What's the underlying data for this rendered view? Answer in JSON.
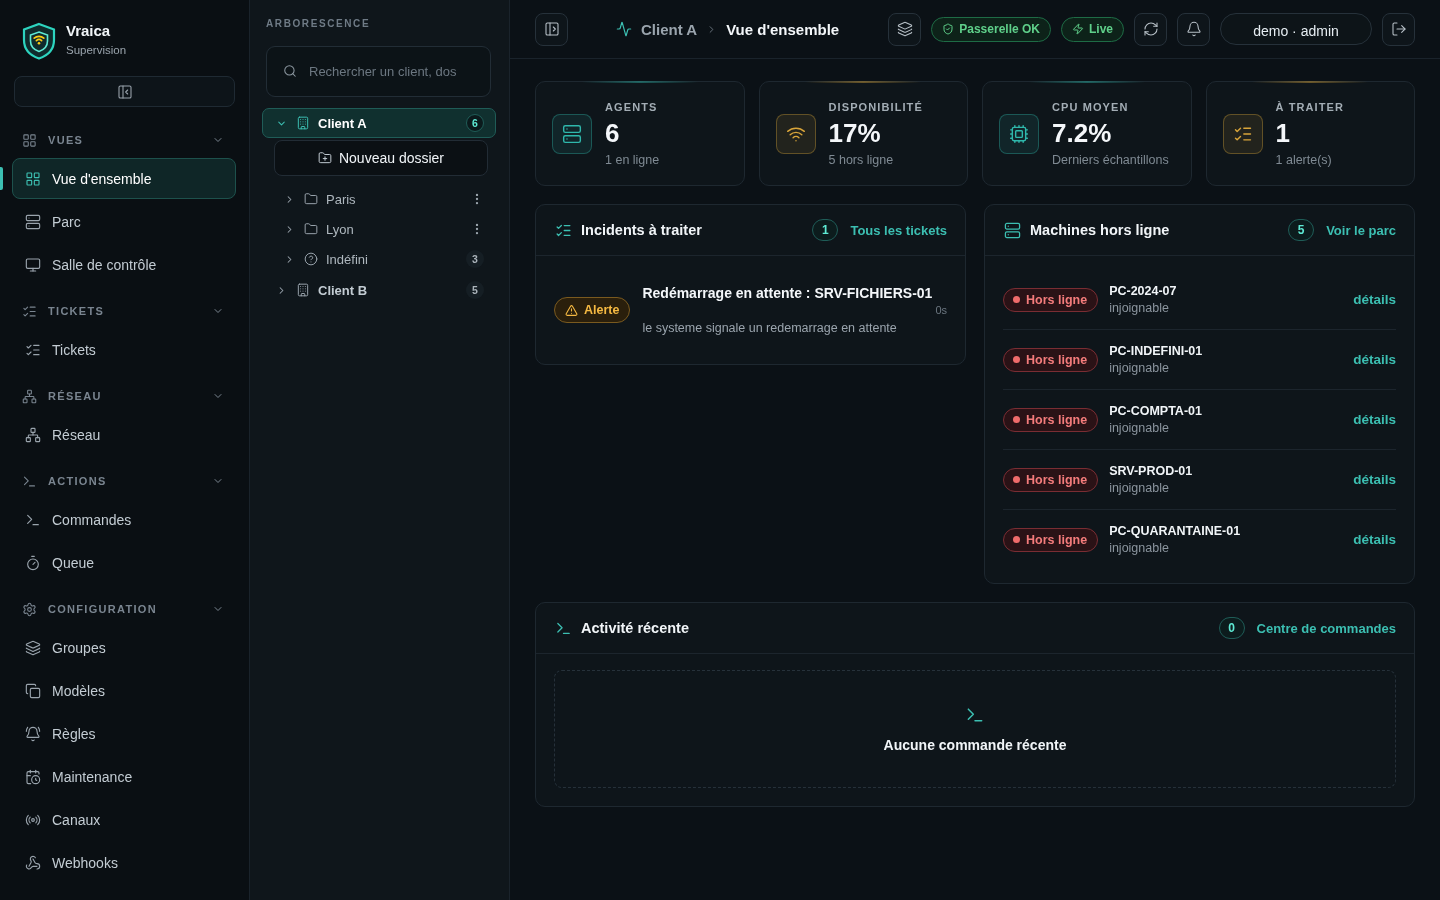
{
  "brand": {
    "name": "Vraica",
    "subtitle": "Supervision"
  },
  "sidebar": {
    "sections": [
      {
        "title": "VUES",
        "expanded": true,
        "items": [
          {
            "label": "Vue d'ensemble",
            "selected": true
          },
          {
            "label": "Parc",
            "selected": false
          },
          {
            "label": "Salle de contrôle",
            "selected": false
          }
        ]
      },
      {
        "title": "TICKETS",
        "expanded": true,
        "items": [
          {
            "label": "Tickets",
            "selected": false
          }
        ]
      },
      {
        "title": "RÉSEAU",
        "expanded": true,
        "items": [
          {
            "label": "Réseau",
            "selected": false
          }
        ]
      },
      {
        "title": "ACTIONS",
        "expanded": true,
        "items": [
          {
            "label": "Commandes",
            "selected": false
          },
          {
            "label": "Queue",
            "selected": false
          }
        ]
      },
      {
        "title": "CONFIGURATION",
        "expanded": true,
        "items": [
          {
            "label": "Groupes",
            "selected": false
          },
          {
            "label": "Modèles",
            "selected": false
          },
          {
            "label": "Règles",
            "selected": false
          },
          {
            "label": "Maintenance",
            "selected": false
          },
          {
            "label": "Canaux",
            "selected": false
          },
          {
            "label": "Webhooks",
            "selected": false
          }
        ]
      }
    ]
  },
  "tree": {
    "title": "ARBORESCENCE",
    "search": {
      "placeholder": "Rechercher un client, dos"
    },
    "nodes": [
      {
        "kind": "client",
        "label": "Client A",
        "count": "6",
        "selected": true,
        "expanded": true,
        "new_folder_button": "Nouveau dossier",
        "children": [
          {
            "kind": "folder",
            "label": "Paris",
            "selected": false,
            "expanded": false
          },
          {
            "kind": "folder",
            "label": "Lyon",
            "selected": false,
            "expanded": false
          },
          {
            "kind": "unassigned",
            "label": "Indéfini",
            "count": "3",
            "selected": false,
            "expanded": false
          }
        ]
      },
      {
        "kind": "client",
        "label": "Client B",
        "count": "5",
        "selected": false,
        "expanded": false
      }
    ]
  },
  "topbar": {
    "breadcrumb": [
      "Client A",
      "Vue d'ensemble"
    ],
    "status_pills": [
      {
        "label": "Passerelle OK"
      },
      {
        "label": "Live"
      }
    ],
    "user": "demo · admin"
  },
  "stats": [
    {
      "label": "AGENTS",
      "value": "6",
      "sub": "1 en ligne",
      "color": "#2fb8ac"
    },
    {
      "label": "DISPONIBILITÉ",
      "value": "17%",
      "sub": "5 hors ligne",
      "color": "#d9a53a"
    },
    {
      "label": "CPU MOYEN",
      "value": "7.2%",
      "sub": "Derniers échantillons",
      "color": "#2fb8ac"
    },
    {
      "label": "À TRAITER",
      "value": "1",
      "sub": "1 alerte(s)",
      "color": "#d9a53a"
    }
  ],
  "incidents": {
    "title": "Incidents à traiter",
    "count": "1",
    "link": "Tous les tickets",
    "items": [
      {
        "severity": "Alerte",
        "title": "Redémarrage en attente : SRV-FICHIERS-01",
        "age": "0s",
        "description": "le systeme signale un redemarrage en attente"
      }
    ]
  },
  "offline_machines": {
    "title": "Machines hors ligne",
    "count": "5",
    "link": "Voir le parc",
    "items": [
      {
        "status": "Hors ligne",
        "name": "PC-2024-07",
        "detail": "injoignable",
        "action": "détails"
      },
      {
        "status": "Hors ligne",
        "name": "PC-INDEFINI-01",
        "detail": "injoignable",
        "action": "détails"
      },
      {
        "status": "Hors ligne",
        "name": "PC-COMPTA-01",
        "detail": "injoignable",
        "action": "détails"
      },
      {
        "status": "Hors ligne",
        "name": "SRV-PROD-01",
        "detail": "injoignable",
        "action": "détails"
      },
      {
        "status": "Hors ligne",
        "name": "PC-QUARANTAINE-01",
        "detail": "injoignable",
        "action": "détails"
      }
    ]
  },
  "recent_activity": {
    "title": "Activité récente",
    "count": "0",
    "link": "Centre de commandes",
    "empty_text": "Aucune commande récente"
  }
}
